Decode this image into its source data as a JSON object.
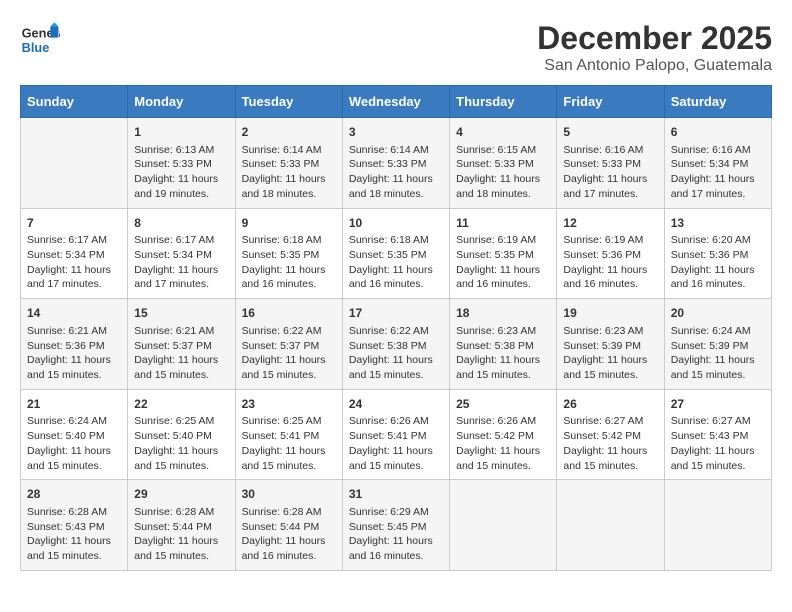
{
  "logo": {
    "line1": "General",
    "line2": "Blue"
  },
  "title": "December 2025",
  "subtitle": "San Antonio Palopo, Guatemala",
  "days_header": [
    "Sunday",
    "Monday",
    "Tuesday",
    "Wednesday",
    "Thursday",
    "Friday",
    "Saturday"
  ],
  "weeks": [
    [
      {
        "day": "",
        "sunrise": "",
        "sunset": "",
        "daylight": ""
      },
      {
        "day": "1",
        "sunrise": "Sunrise: 6:13 AM",
        "sunset": "Sunset: 5:33 PM",
        "daylight": "Daylight: 11 hours and 19 minutes."
      },
      {
        "day": "2",
        "sunrise": "Sunrise: 6:14 AM",
        "sunset": "Sunset: 5:33 PM",
        "daylight": "Daylight: 11 hours and 18 minutes."
      },
      {
        "day": "3",
        "sunrise": "Sunrise: 6:14 AM",
        "sunset": "Sunset: 5:33 PM",
        "daylight": "Daylight: 11 hours and 18 minutes."
      },
      {
        "day": "4",
        "sunrise": "Sunrise: 6:15 AM",
        "sunset": "Sunset: 5:33 PM",
        "daylight": "Daylight: 11 hours and 18 minutes."
      },
      {
        "day": "5",
        "sunrise": "Sunrise: 6:16 AM",
        "sunset": "Sunset: 5:33 PM",
        "daylight": "Daylight: 11 hours and 17 minutes."
      },
      {
        "day": "6",
        "sunrise": "Sunrise: 6:16 AM",
        "sunset": "Sunset: 5:34 PM",
        "daylight": "Daylight: 11 hours and 17 minutes."
      }
    ],
    [
      {
        "day": "7",
        "sunrise": "Sunrise: 6:17 AM",
        "sunset": "Sunset: 5:34 PM",
        "daylight": "Daylight: 11 hours and 17 minutes."
      },
      {
        "day": "8",
        "sunrise": "Sunrise: 6:17 AM",
        "sunset": "Sunset: 5:34 PM",
        "daylight": "Daylight: 11 hours and 17 minutes."
      },
      {
        "day": "9",
        "sunrise": "Sunrise: 6:18 AM",
        "sunset": "Sunset: 5:35 PM",
        "daylight": "Daylight: 11 hours and 16 minutes."
      },
      {
        "day": "10",
        "sunrise": "Sunrise: 6:18 AM",
        "sunset": "Sunset: 5:35 PM",
        "daylight": "Daylight: 11 hours and 16 minutes."
      },
      {
        "day": "11",
        "sunrise": "Sunrise: 6:19 AM",
        "sunset": "Sunset: 5:35 PM",
        "daylight": "Daylight: 11 hours and 16 minutes."
      },
      {
        "day": "12",
        "sunrise": "Sunrise: 6:19 AM",
        "sunset": "Sunset: 5:36 PM",
        "daylight": "Daylight: 11 hours and 16 minutes."
      },
      {
        "day": "13",
        "sunrise": "Sunrise: 6:20 AM",
        "sunset": "Sunset: 5:36 PM",
        "daylight": "Daylight: 11 hours and 16 minutes."
      }
    ],
    [
      {
        "day": "14",
        "sunrise": "Sunrise: 6:21 AM",
        "sunset": "Sunset: 5:36 PM",
        "daylight": "Daylight: 11 hours and 15 minutes."
      },
      {
        "day": "15",
        "sunrise": "Sunrise: 6:21 AM",
        "sunset": "Sunset: 5:37 PM",
        "daylight": "Daylight: 11 hours and 15 minutes."
      },
      {
        "day": "16",
        "sunrise": "Sunrise: 6:22 AM",
        "sunset": "Sunset: 5:37 PM",
        "daylight": "Daylight: 11 hours and 15 minutes."
      },
      {
        "day": "17",
        "sunrise": "Sunrise: 6:22 AM",
        "sunset": "Sunset: 5:38 PM",
        "daylight": "Daylight: 11 hours and 15 minutes."
      },
      {
        "day": "18",
        "sunrise": "Sunrise: 6:23 AM",
        "sunset": "Sunset: 5:38 PM",
        "daylight": "Daylight: 11 hours and 15 minutes."
      },
      {
        "day": "19",
        "sunrise": "Sunrise: 6:23 AM",
        "sunset": "Sunset: 5:39 PM",
        "daylight": "Daylight: 11 hours and 15 minutes."
      },
      {
        "day": "20",
        "sunrise": "Sunrise: 6:24 AM",
        "sunset": "Sunset: 5:39 PM",
        "daylight": "Daylight: 11 hours and 15 minutes."
      }
    ],
    [
      {
        "day": "21",
        "sunrise": "Sunrise: 6:24 AM",
        "sunset": "Sunset: 5:40 PM",
        "daylight": "Daylight: 11 hours and 15 minutes."
      },
      {
        "day": "22",
        "sunrise": "Sunrise: 6:25 AM",
        "sunset": "Sunset: 5:40 PM",
        "daylight": "Daylight: 11 hours and 15 minutes."
      },
      {
        "day": "23",
        "sunrise": "Sunrise: 6:25 AM",
        "sunset": "Sunset: 5:41 PM",
        "daylight": "Daylight: 11 hours and 15 minutes."
      },
      {
        "day": "24",
        "sunrise": "Sunrise: 6:26 AM",
        "sunset": "Sunset: 5:41 PM",
        "daylight": "Daylight: 11 hours and 15 minutes."
      },
      {
        "day": "25",
        "sunrise": "Sunrise: 6:26 AM",
        "sunset": "Sunset: 5:42 PM",
        "daylight": "Daylight: 11 hours and 15 minutes."
      },
      {
        "day": "26",
        "sunrise": "Sunrise: 6:27 AM",
        "sunset": "Sunset: 5:42 PM",
        "daylight": "Daylight: 11 hours and 15 minutes."
      },
      {
        "day": "27",
        "sunrise": "Sunrise: 6:27 AM",
        "sunset": "Sunset: 5:43 PM",
        "daylight": "Daylight: 11 hours and 15 minutes."
      }
    ],
    [
      {
        "day": "28",
        "sunrise": "Sunrise: 6:28 AM",
        "sunset": "Sunset: 5:43 PM",
        "daylight": "Daylight: 11 hours and 15 minutes."
      },
      {
        "day": "29",
        "sunrise": "Sunrise: 6:28 AM",
        "sunset": "Sunset: 5:44 PM",
        "daylight": "Daylight: 11 hours and 15 minutes."
      },
      {
        "day": "30",
        "sunrise": "Sunrise: 6:28 AM",
        "sunset": "Sunset: 5:44 PM",
        "daylight": "Daylight: 11 hours and 16 minutes."
      },
      {
        "day": "31",
        "sunrise": "Sunrise: 6:29 AM",
        "sunset": "Sunset: 5:45 PM",
        "daylight": "Daylight: 11 hours and 16 minutes."
      },
      {
        "day": "",
        "sunrise": "",
        "sunset": "",
        "daylight": ""
      },
      {
        "day": "",
        "sunrise": "",
        "sunset": "",
        "daylight": ""
      },
      {
        "day": "",
        "sunrise": "",
        "sunset": "",
        "daylight": ""
      }
    ]
  ]
}
